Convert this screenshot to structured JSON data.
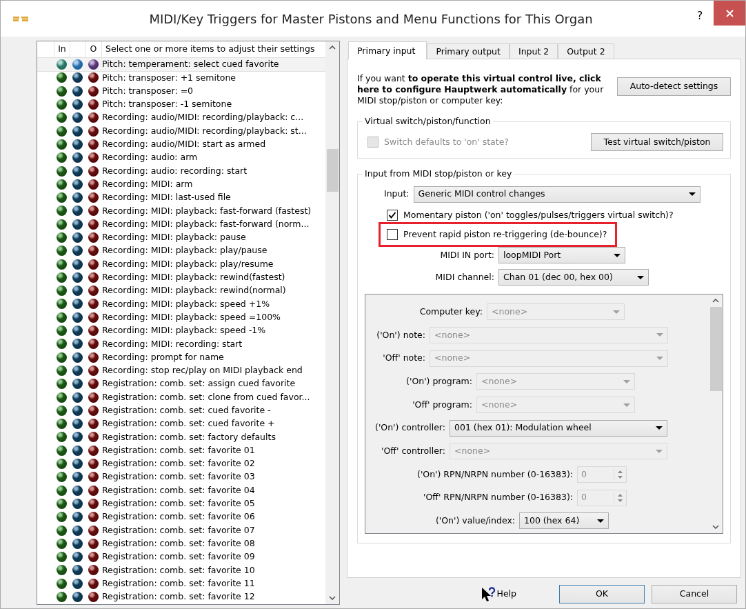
{
  "window": {
    "title": "MIDI/Key Triggers for Master Pistons and Menu Functions for This Organ",
    "help_glyph": "?"
  },
  "list": {
    "header": {
      "in": "In",
      "out": "O",
      "description": "Select one or more items to adjust their settings"
    },
    "items": [
      {
        "label": "Pitch: temperament: select cued favorite",
        "selected": true
      },
      {
        "label": "Pitch: transposer: +1 semitone",
        "selected": false
      },
      {
        "label": "Pitch: transposer: =0",
        "selected": false
      },
      {
        "label": "Pitch: transposer: -1 semitone",
        "selected": false
      },
      {
        "label": "Recording: audio/MIDI: recording/playback: c...",
        "selected": false
      },
      {
        "label": "Recording: audio/MIDI: recording/playback: st...",
        "selected": false
      },
      {
        "label": "Recording: audio/MIDI: start as armed",
        "selected": false
      },
      {
        "label": "Recording: audio: arm",
        "selected": false
      },
      {
        "label": "Recording: audio: recording: start",
        "selected": false
      },
      {
        "label": "Recording: MIDI: arm",
        "selected": false
      },
      {
        "label": "Recording: MIDI: last-used file",
        "selected": false
      },
      {
        "label": "Recording: MIDI: playback: fast-forward (fastest)",
        "selected": false
      },
      {
        "label": "Recording: MIDI: playback: fast-forward (norm...",
        "selected": false
      },
      {
        "label": "Recording: MIDI: playback: pause",
        "selected": false
      },
      {
        "label": "Recording: MIDI: playback: play/pause",
        "selected": false
      },
      {
        "label": "Recording: MIDI: playback: play/resume",
        "selected": false
      },
      {
        "label": "Recording: MIDI: playback: rewind(fastest)",
        "selected": false
      },
      {
        "label": "Recording: MIDI: playback: rewind(normal)",
        "selected": false
      },
      {
        "label": "Recording: MIDI: playback: speed +1%",
        "selected": false
      },
      {
        "label": "Recording: MIDI: playback: speed =100%",
        "selected": false
      },
      {
        "label": "Recording: MIDI: playback: speed -1%",
        "selected": false
      },
      {
        "label": "Recording: MIDI: recording: start",
        "selected": false
      },
      {
        "label": "Recording: prompt for name",
        "selected": false
      },
      {
        "label": "Recording: stop rec/play on MIDI playback end",
        "selected": false
      },
      {
        "label": "Registration: comb. set: assign cued favorite",
        "selected": false
      },
      {
        "label": "Registration: comb. set: clone from cued favor...",
        "selected": false
      },
      {
        "label": "Registration: comb. set: cued favorite -",
        "selected": false
      },
      {
        "label": "Registration: comb. set: cued favorite +",
        "selected": false
      },
      {
        "label": "Registration: comb. set: factory defaults",
        "selected": false
      },
      {
        "label": "Registration: comb. set: favorite 01",
        "selected": false
      },
      {
        "label": "Registration: comb. set: favorite 02",
        "selected": false
      },
      {
        "label": "Registration: comb. set: favorite 03",
        "selected": false
      },
      {
        "label": "Registration: comb. set: favorite 04",
        "selected": false
      },
      {
        "label": "Registration: comb. set: favorite 05",
        "selected": false
      },
      {
        "label": "Registration: comb. set: favorite 06",
        "selected": false
      },
      {
        "label": "Registration: comb. set: favorite 07",
        "selected": false
      },
      {
        "label": "Registration: comb. set: favorite 08",
        "selected": false
      },
      {
        "label": "Registration: comb. set: favorite 09",
        "selected": false
      },
      {
        "label": "Registration: comb. set: favorite 10",
        "selected": false
      },
      {
        "label": "Registration: comb. set: favorite 11",
        "selected": false
      },
      {
        "label": "Registration: comb. set: favorite 12",
        "selected": false
      }
    ]
  },
  "tabs": [
    {
      "label": "Primary input",
      "selected": true
    },
    {
      "label": "Primary output",
      "selected": false
    },
    {
      "label": "Input 2",
      "selected": false
    },
    {
      "label": "Output 2",
      "selected": false
    }
  ],
  "intro": {
    "text": "If you want **to operate this virtual control live, click here to configure Hauptwerk automatically** for your MIDI stop/piston or computer key:",
    "button": "Auto-detect settings"
  },
  "virtual_group": {
    "legend": "Virtual switch/piston/function",
    "checkbox": {
      "label": "Switch defaults to 'on' state?",
      "checked": false,
      "disabled": true
    },
    "button": "Test virtual switch/piston"
  },
  "input_group": {
    "legend": "Input from MIDI stop/piston or key",
    "input": {
      "label": "Input:",
      "value": "Generic MIDI control changes"
    },
    "checkboxes": [
      {
        "label": "Momentary piston ('on' toggles/pulses/triggers virtual switch)?",
        "checked": true,
        "highlighted": false
      },
      {
        "label": "Prevent rapid piston re-triggering (de-bounce)?",
        "checked": false,
        "highlighted": true
      }
    ],
    "port": {
      "label": "MIDI IN port:",
      "value": "loopMIDI Port"
    },
    "channel": {
      "label": "MIDI channel:",
      "value": "Chan 01 (dec 00, hex 00)"
    },
    "fields": [
      {
        "kind": "select",
        "label": "Computer key:",
        "value": "<none>",
        "disabled": true
      },
      {
        "kind": "select",
        "label": "('On') note:",
        "value": "<none>",
        "disabled": true
      },
      {
        "kind": "select",
        "label": "'Off' note:",
        "value": "<none>",
        "disabled": true
      },
      {
        "kind": "select",
        "label": "('On') program:",
        "value": "<none>",
        "disabled": true
      },
      {
        "kind": "select",
        "label": "'Off' program:",
        "value": "<none>",
        "disabled": true
      },
      {
        "kind": "select",
        "label": "('On') controller:",
        "value": "001 (hex 01): Modulation wheel",
        "disabled": false
      },
      {
        "kind": "select",
        "label": "'Off' controller:",
        "value": "<none>",
        "disabled": true
      },
      {
        "kind": "spin",
        "label": "('On') RPN/NRPN number (0-16383):",
        "value": "0",
        "disabled": true
      },
      {
        "kind": "spin",
        "label": "'Off' RPN/NRPN number (0-16383):",
        "value": "0",
        "disabled": true
      },
      {
        "kind": "select",
        "label": "('On') value/index:",
        "value": "100 (hex 64)",
        "disabled": false
      }
    ]
  },
  "footer": {
    "help": "Help",
    "ok": "OK",
    "cancel": "Cancel"
  }
}
